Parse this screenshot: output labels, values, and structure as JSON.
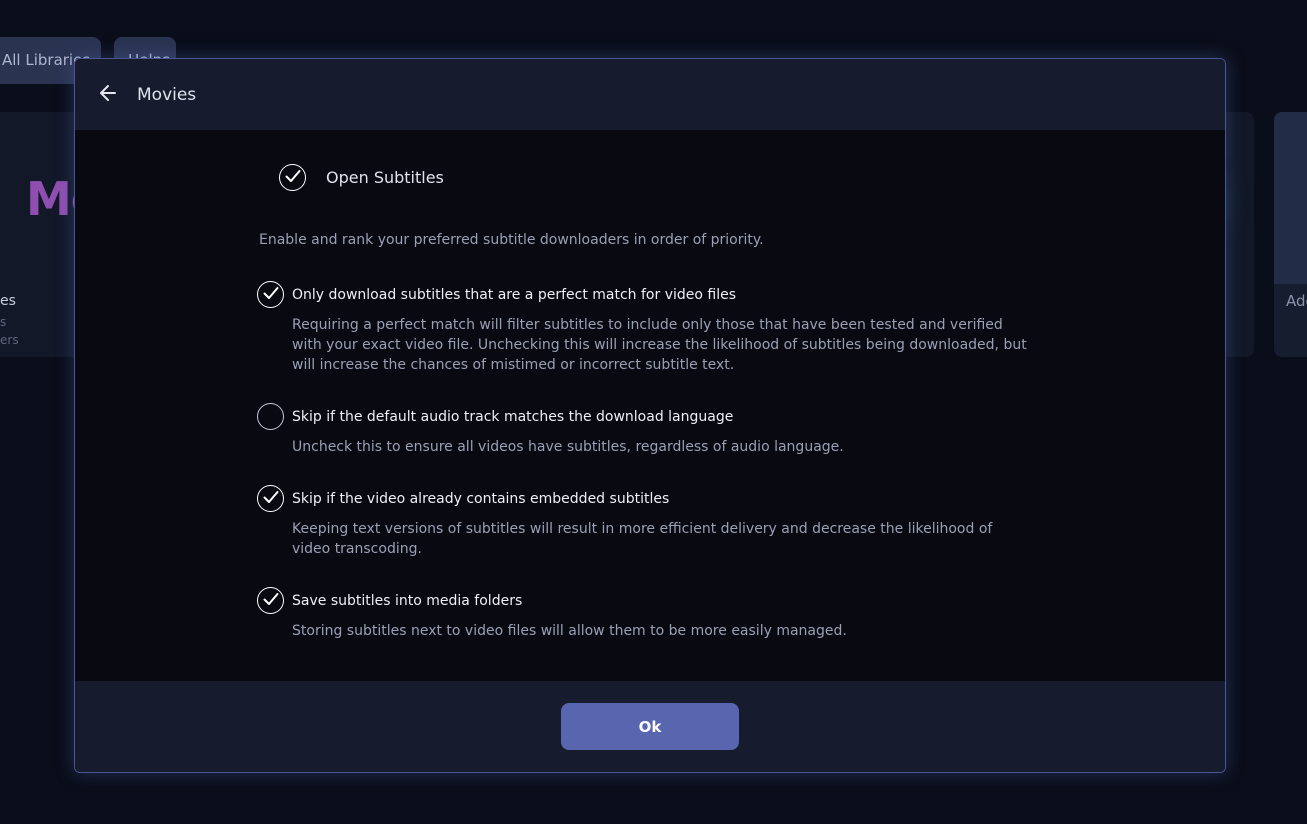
{
  "background": {
    "tabs": [
      "All Libraries",
      "Helps"
    ],
    "logo_text": "Mo",
    "side_texts": [
      "es",
      "s",
      "ers"
    ],
    "add_text": "Add"
  },
  "dialog": {
    "title": "Movies",
    "provider": {
      "label": "Open Subtitles",
      "checked": true
    },
    "intro": "Enable and rank your preferred subtitle downloaders in order of priority.",
    "options": [
      {
        "label": "Only download subtitles that are a perfect match for video files",
        "description": "Requiring a perfect match will filter subtitles to include only those that have been tested and verified with your exact video file. Unchecking this will increase the likelihood of subtitles being downloaded, but will increase the chances of mistimed or incorrect subtitle text.",
        "checked": true
      },
      {
        "label": "Skip if the default audio track matches the download language",
        "description": "Uncheck this to ensure all videos have subtitles, regardless of audio language.",
        "checked": false
      },
      {
        "label": "Skip if the video already contains embedded subtitles",
        "description": "Keeping text versions of subtitles will result in more efficient delivery and decrease the likelihood of video transcoding.",
        "checked": true
      },
      {
        "label": "Save subtitles into media folders",
        "description": "Storing subtitles next to video files will allow them to be more easily managed.",
        "checked": true
      }
    ],
    "ok_label": "Ok"
  },
  "colors": {
    "accent": "#5866b0",
    "header_bg": "#161b2d",
    "body_bg": "#000000"
  },
  "icons": {
    "back": "arrow-left-icon",
    "check": "checkmark-icon"
  }
}
